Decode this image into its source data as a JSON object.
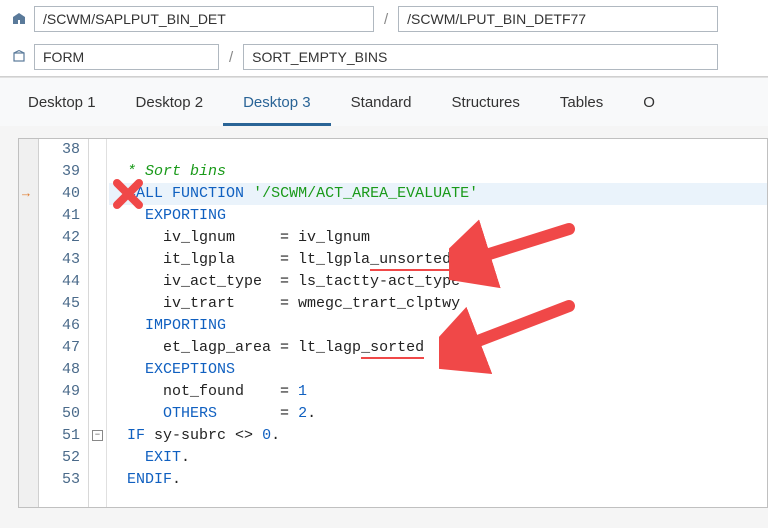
{
  "nav1": {
    "field1": "/SCWM/SAPLPUT_BIN_DET",
    "sep": "/",
    "field2": "/SCWM/LPUT_BIN_DETF77"
  },
  "nav2": {
    "field1": "FORM",
    "sep": "/",
    "field2": "SORT_EMPTY_BINS"
  },
  "tabs": [
    "Desktop 1",
    "Desktop 2",
    "Desktop 3",
    "Standard",
    "Structures",
    "Tables",
    "O"
  ],
  "activeTab": 2,
  "code": {
    "start": 38,
    "lines": [
      {
        "n": 38,
        "t": ""
      },
      {
        "n": 39,
        "t": "* Sort bins",
        "cmt": true
      },
      {
        "n": 40,
        "t": "CALL FUNCTION '/SCWM/ACT_AREA_EVALUATE'",
        "hl": true,
        "marker": true
      },
      {
        "n": 41,
        "t": "  EXPORTING"
      },
      {
        "n": 42,
        "t": "    iv_lgnum     = iv_lgnum"
      },
      {
        "n": 43,
        "t": "    it_lgpla     = lt_lgpla_unsorted",
        "u1": "_unsorted"
      },
      {
        "n": 44,
        "t": "    iv_act_type  = ls_tactty-act_type"
      },
      {
        "n": 45,
        "t": "    iv_trart     = wmegc_trart_clptwy"
      },
      {
        "n": 46,
        "t": "  IMPORTING"
      },
      {
        "n": 47,
        "t": "    et_lagp_area = lt_lagp_sorted",
        "u1": "_sorted"
      },
      {
        "n": 48,
        "t": "  EXCEPTIONS"
      },
      {
        "n": 49,
        "t": "    not_found    = 1"
      },
      {
        "n": 50,
        "t": "    OTHERS       = 2."
      },
      {
        "n": 51,
        "t": "IF sy-subrc <> 0.",
        "fold": true
      },
      {
        "n": 52,
        "t": "  EXIT."
      },
      {
        "n": 53,
        "t": "ENDIF."
      }
    ]
  }
}
